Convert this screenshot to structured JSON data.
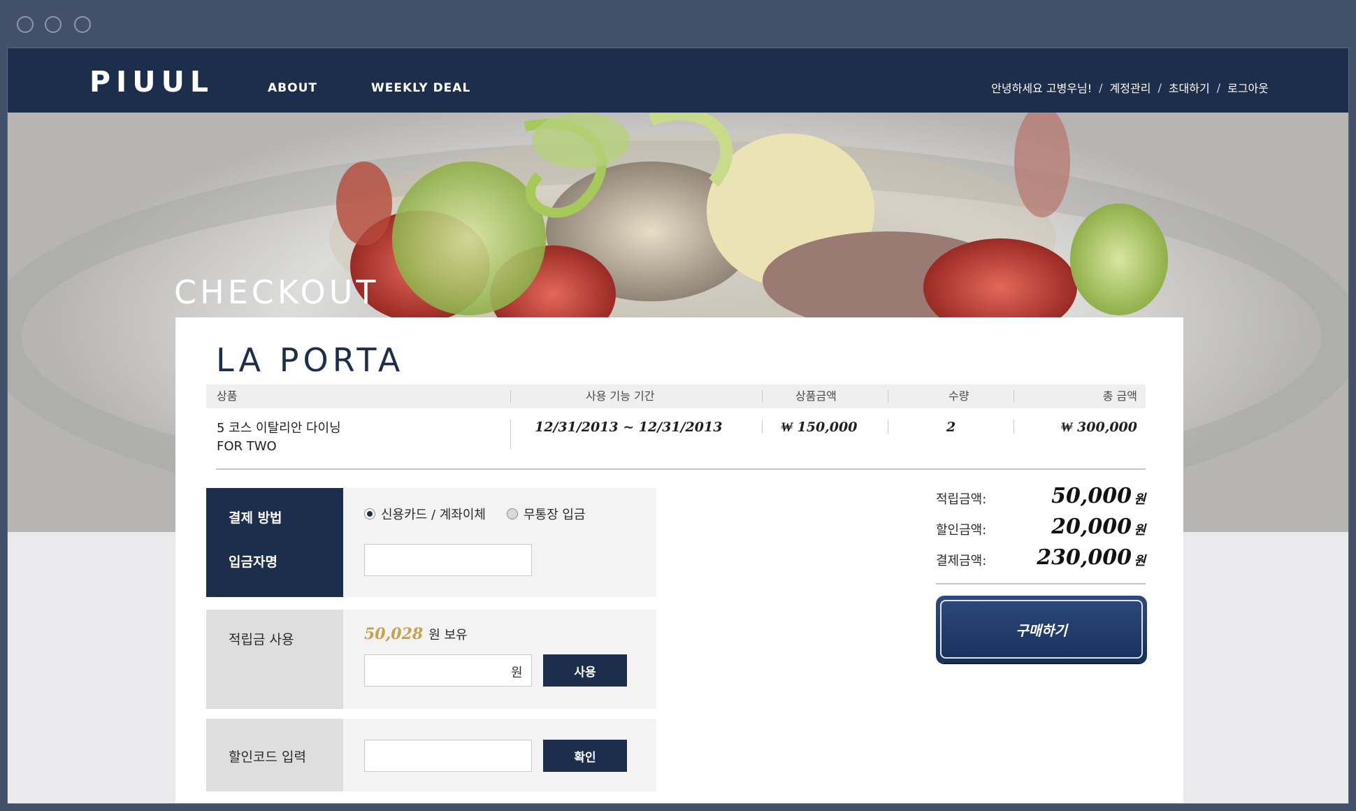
{
  "brand": {
    "logo": "PIUUL"
  },
  "nav": {
    "links": [
      "ABOUT",
      "WEEKLY DEAL"
    ],
    "greeting": "안녕하세요 고병우님!",
    "account_links": [
      "계정관리",
      "초대하기",
      "로그아웃"
    ],
    "separator": "/"
  },
  "hero": {
    "title": "CHECKOUT"
  },
  "order": {
    "venue": "LA PORTA",
    "columns": [
      "상품",
      "사용 기능 기간",
      "상품금액",
      "수량",
      "총 금액"
    ],
    "row": {
      "product_line1": "5 코스 이탈리안 다이닝",
      "product_line2": "FOR TWO",
      "period": "12/31/2013 ~ 12/31/2013",
      "price": "₩ 150,000",
      "quantity": "2",
      "total": "₩ 300,000"
    }
  },
  "payment": {
    "method_label": "결제 방법",
    "depositor_label": "입금자명",
    "options": [
      "신용카드 / 계좌이체",
      "무통장 입금"
    ],
    "selected_option": "신용카드 / 계좌이체",
    "depositor_value": ""
  },
  "points": {
    "label": "적립금 사용",
    "balance": "50,028",
    "balance_suffix": "원 보유",
    "input_value": "",
    "input_unit": "원",
    "use_button": "사용"
  },
  "coupon": {
    "label": "할인코드 입력",
    "input_value": "",
    "confirm_button": "확인"
  },
  "summary": {
    "rows": [
      {
        "label": "적립금액:",
        "value": "50,000",
        "unit": "원"
      },
      {
        "label": "할인금액:",
        "value": "20,000",
        "unit": "원"
      },
      {
        "label": "결제금액:",
        "value": "230,000",
        "unit": "원"
      }
    ],
    "buy_button": "구매하기"
  },
  "colors": {
    "navy": "#1d2d4c",
    "gold": "#c8a24a",
    "chrome": "#43506a"
  }
}
